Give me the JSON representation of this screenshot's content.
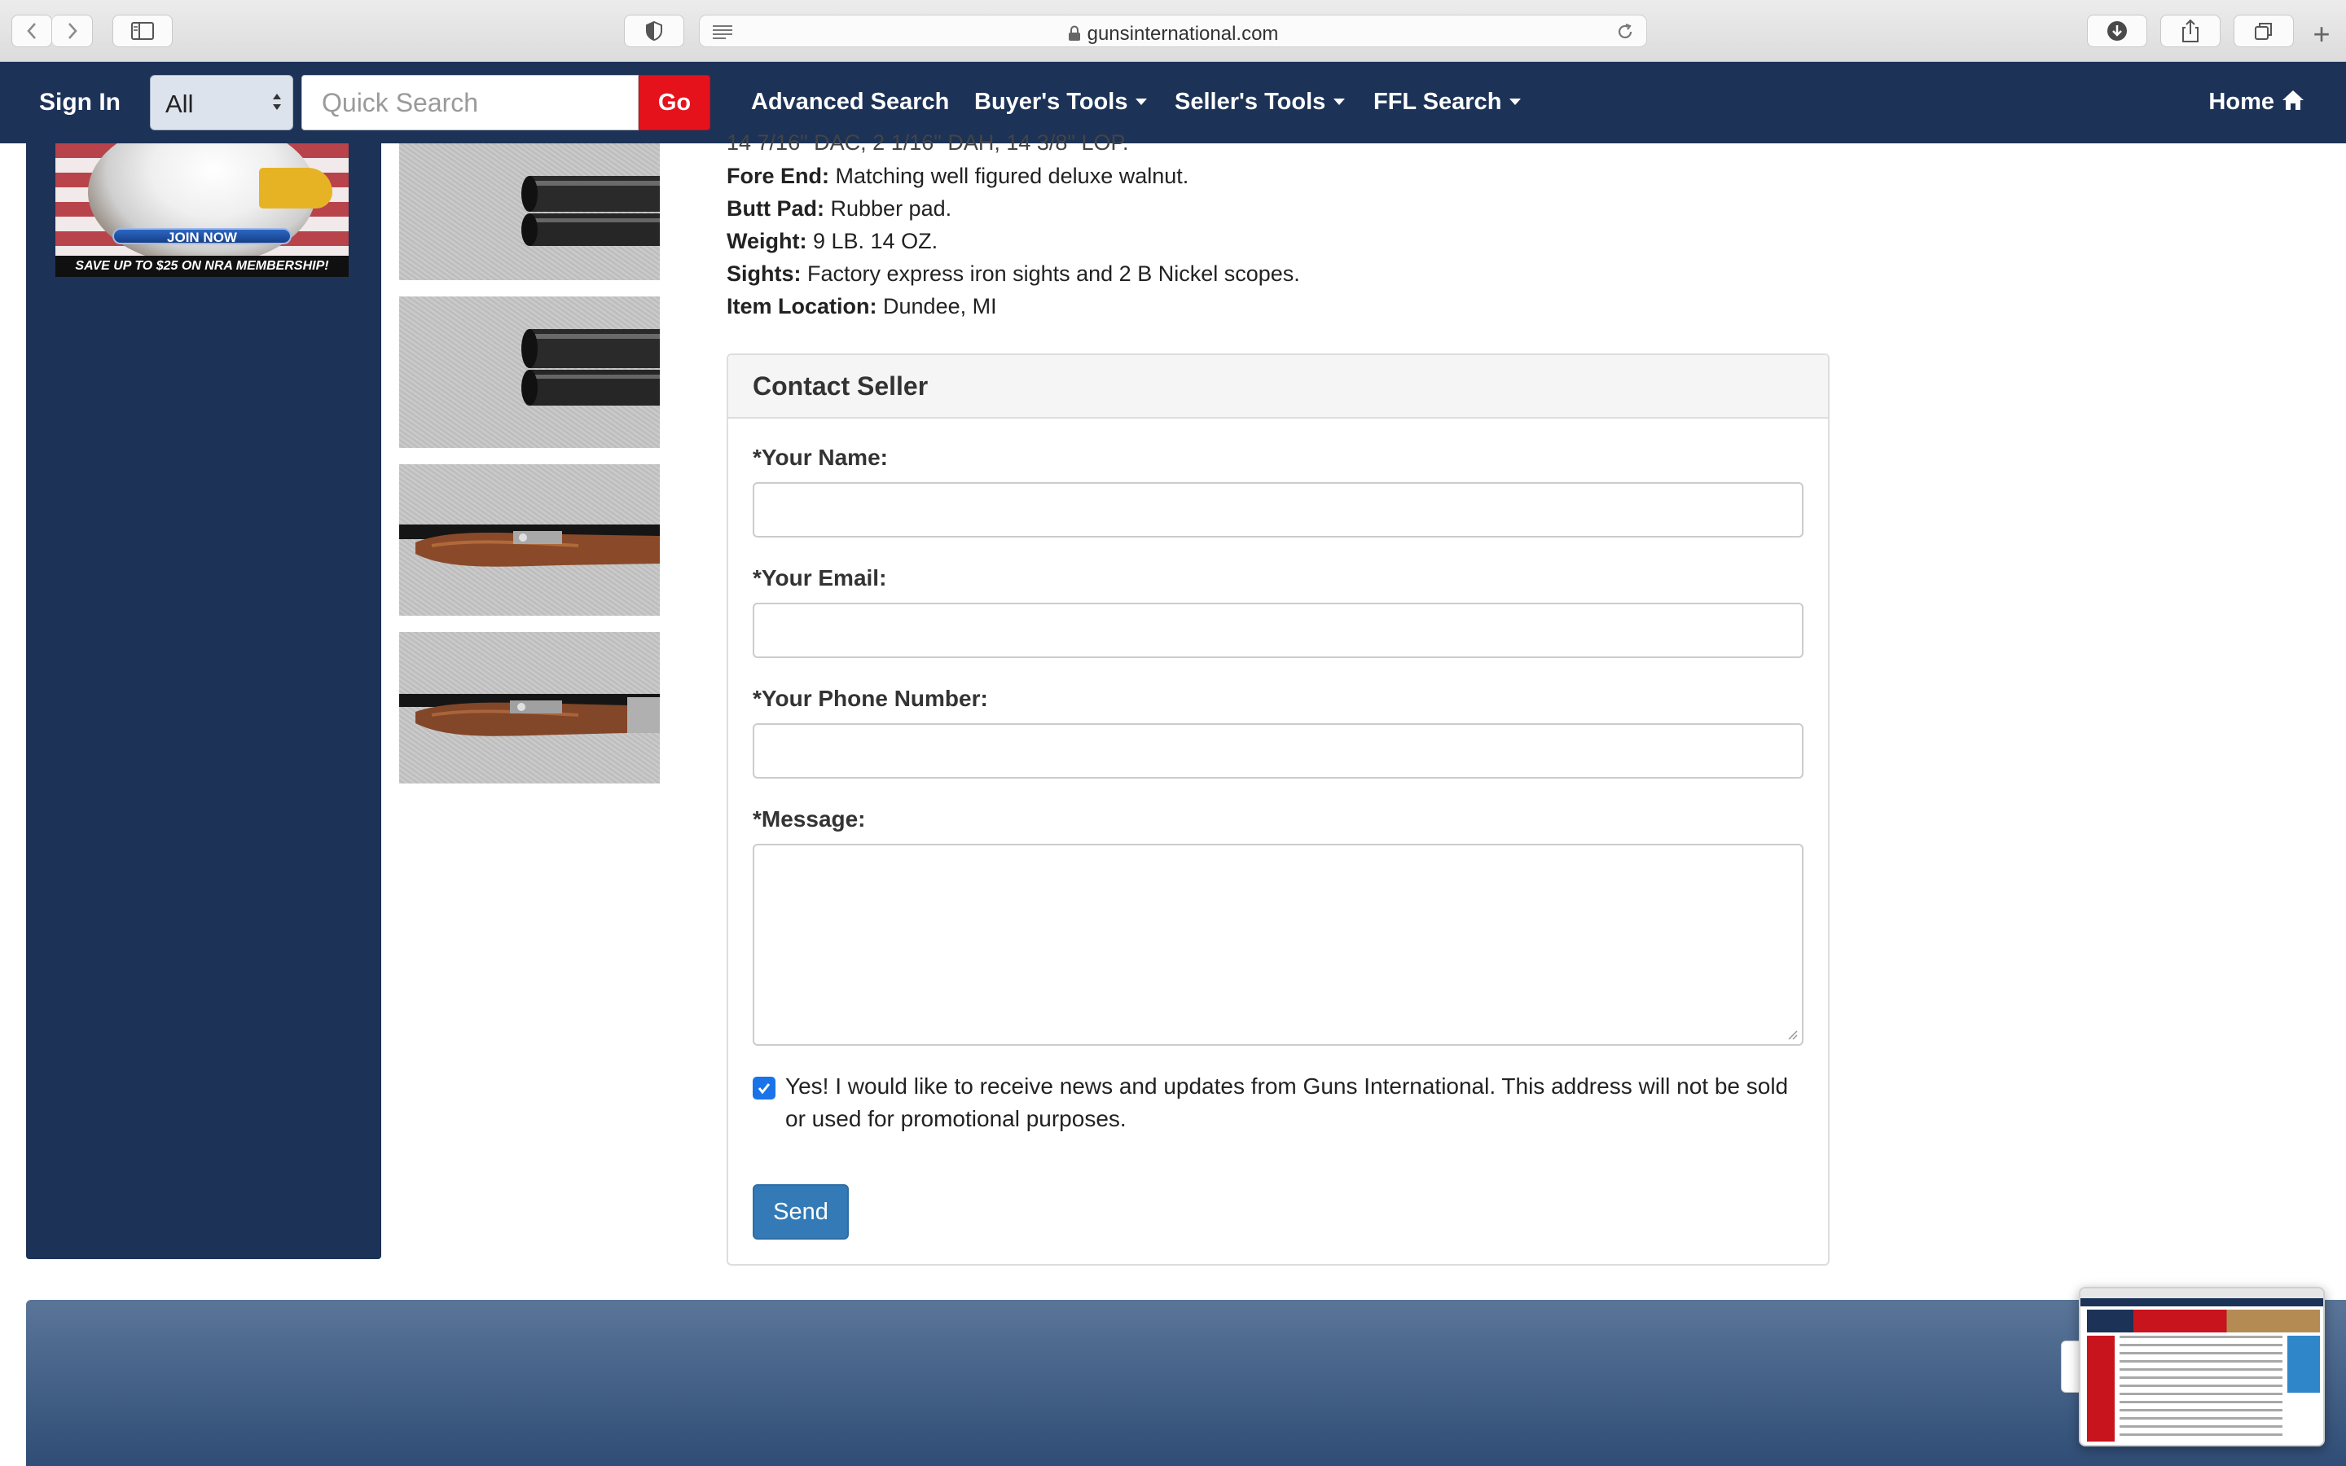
{
  "browser": {
    "url": "gunsinternational.com",
    "new_tab_glyph": "+"
  },
  "nav": {
    "sign_in": "Sign In",
    "category_select": "All",
    "search_placeholder": "Quick Search",
    "go": "Go",
    "links": {
      "advanced_search": "Advanced Search",
      "buyers_tools": "Buyer's Tools",
      "sellers_tools": "Seller's Tools",
      "ffl_search": "FFL Search",
      "home": "Home"
    }
  },
  "sidebar": {
    "ad": {
      "button": "JOIN NOW",
      "tagline": "SAVE UP TO $25 ON NRA MEMBERSHIP!"
    }
  },
  "listing": {
    "partial_line": "14 7/16\" DAC, 2 1/16\" DAH, 14 3/8\" LOP.",
    "details": [
      {
        "label": "Fore End:",
        "value": "Matching well figured deluxe walnut."
      },
      {
        "label": "Butt Pad:",
        "value": "Rubber pad."
      },
      {
        "label": "Weight:",
        "value": "9 LB. 14 OZ."
      },
      {
        "label": "Sights:",
        "value": "Factory express iron sights and 2 B Nickel scopes."
      },
      {
        "label": "Item Location:",
        "value": "Dundee, MI"
      }
    ]
  },
  "contact": {
    "title": "Contact Seller",
    "name_label": "*Your Name:",
    "name_value": "",
    "email_label": "*Your Email:",
    "email_value": "",
    "phone_label": "*Your Phone Number:",
    "phone_value": "",
    "message_label": "*Message:",
    "message_value": "",
    "opt_in_text": "Yes! I would like to receive news and updates from Guns International. This address will not be sold or used for promotional purposes.",
    "opt_in_checked": true,
    "send": "Send"
  },
  "colors": {
    "nav_bg": "#1c3257",
    "go_button": "#e5121b",
    "send_button": "#337ab7",
    "checkbox": "#1a73e8"
  },
  "icons": [
    "back-icon",
    "forward-icon",
    "sidebar-icon",
    "shield-icon",
    "reader-icon",
    "lock-icon",
    "reload-icon",
    "download-icon",
    "share-icon",
    "tabs-icon",
    "home-icon",
    "check-icon"
  ]
}
